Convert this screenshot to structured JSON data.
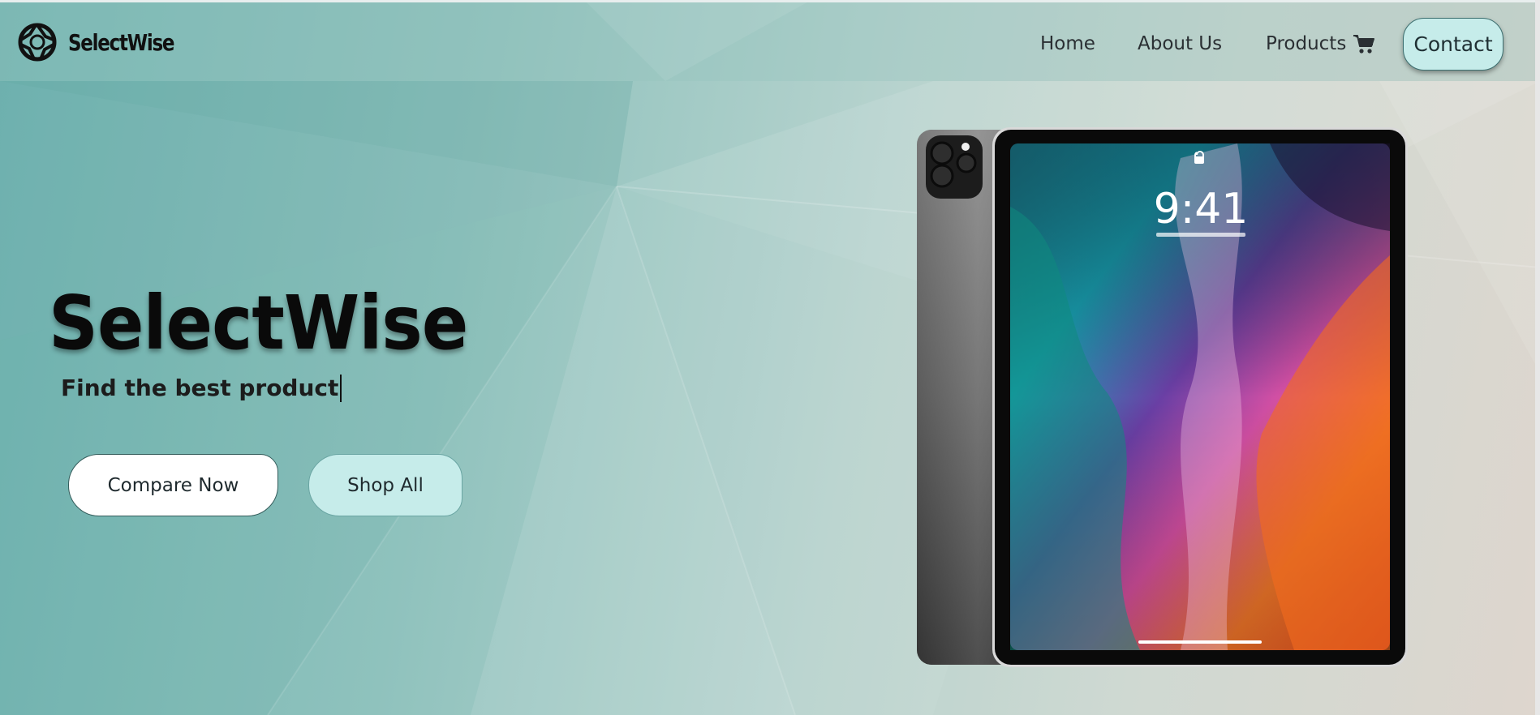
{
  "nav": {
    "brand": "SelectWise",
    "links": [
      "Home",
      "About Us",
      "Products"
    ],
    "contact_label": "Contact",
    "icons": {
      "logo": "aperture-logo-icon",
      "cart": "shopping-cart-icon"
    }
  },
  "hero": {
    "title": "SelectWise",
    "subtitle": "Find the best product",
    "primary_button": "Compare Now",
    "secondary_button": "Shop All"
  },
  "product_image": {
    "device": "tablet",
    "lock_time": "9:41"
  },
  "colors": {
    "accent": "#c6ecea",
    "background_start": "#6fb3b0",
    "background_end": "#ded6ce",
    "text": "#0a0a0a"
  }
}
